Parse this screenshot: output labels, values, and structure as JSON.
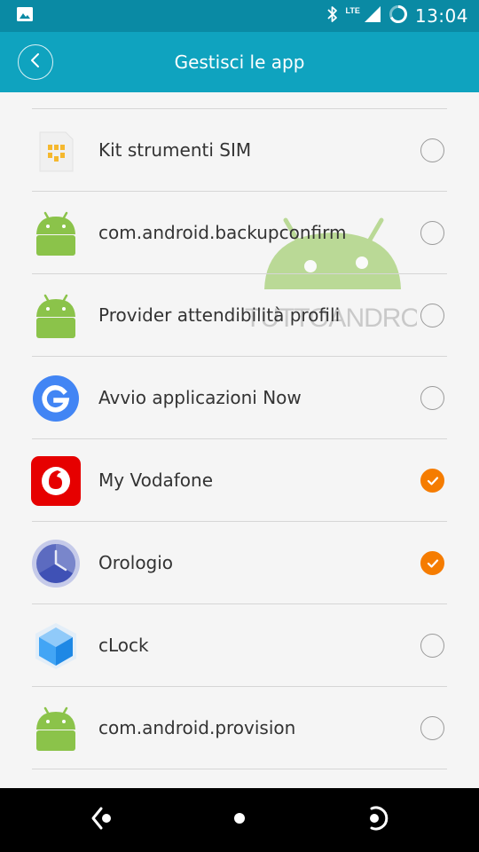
{
  "status_bar": {
    "time": "13:04",
    "network": "LTE"
  },
  "app_bar": {
    "title": "Gestisci le app"
  },
  "watermark": {
    "text": "TUTTOANDROID"
  },
  "apps": [
    {
      "label": "Kit strumenti SIM",
      "icon": "sim-toolkit-icon",
      "checked": false
    },
    {
      "label": "com.android.backupconfirm",
      "icon": "android-robot-icon",
      "checked": false
    },
    {
      "label": "Provider attendibilità profili",
      "icon": "android-robot-icon",
      "checked": false
    },
    {
      "label": "Avvio applicazioni Now",
      "icon": "google-g-icon",
      "checked": false
    },
    {
      "label": "My Vodafone",
      "icon": "vodafone-icon",
      "checked": true
    },
    {
      "label": "Orologio",
      "icon": "clock-icon",
      "checked": true
    },
    {
      "label": "cLock",
      "icon": "clock-cube-icon",
      "checked": false
    },
    {
      "label": "com.android.provision",
      "icon": "android-robot-icon",
      "checked": false
    }
  ],
  "colors": {
    "status_bar": "#0a8aa4",
    "app_bar": "#0fa3bf",
    "accent": "#f57c00"
  }
}
